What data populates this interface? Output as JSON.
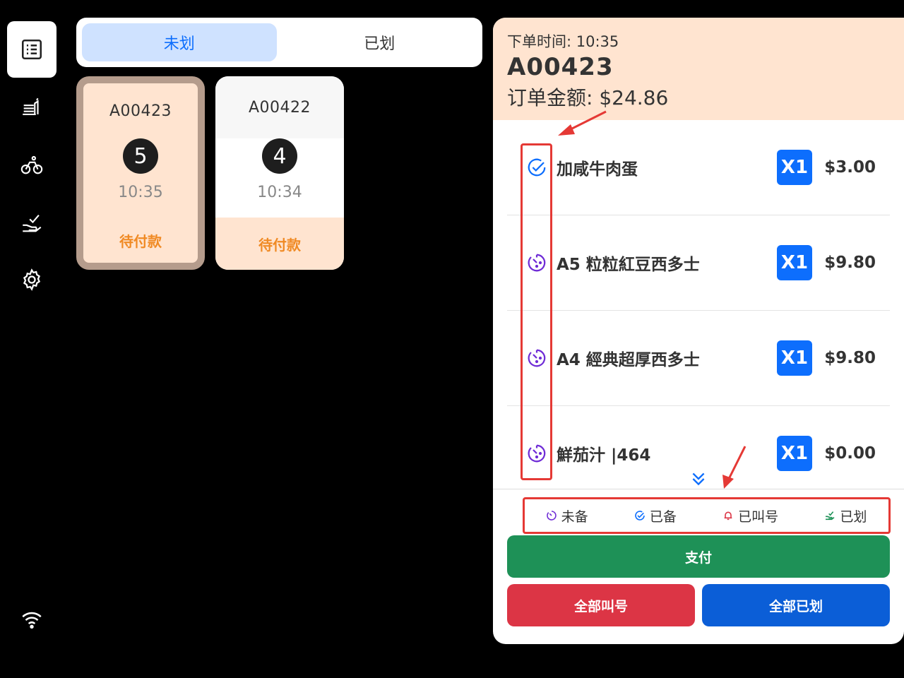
{
  "sidebar": {
    "items": [
      {
        "icon": "order-list-icon",
        "active": true
      },
      {
        "icon": "kitchen-icon",
        "active": false
      },
      {
        "icon": "delivery-bike-icon",
        "active": false
      },
      {
        "icon": "served-hand-icon",
        "active": false
      },
      {
        "icon": "gear-icon",
        "active": false
      }
    ],
    "bottom_icon": "wifi-icon"
  },
  "tabs": [
    {
      "label": "未划",
      "active": true
    },
    {
      "label": "已划",
      "active": false
    }
  ],
  "orders": [
    {
      "id": "A00423",
      "number": "5",
      "time": "10:35",
      "status": "待付款",
      "selected": true
    },
    {
      "id": "A00422",
      "number": "4",
      "time": "10:34",
      "status": "待付款",
      "selected": false
    }
  ],
  "detail": {
    "order_time": "下单时间: 10:35",
    "order_id": "A00423",
    "order_total": "订单金额: $24.86",
    "items": [
      {
        "status_icon": "check-circle-icon",
        "name": "加咸牛肉蛋",
        "qty": "X1",
        "price": "$3.00"
      },
      {
        "status_icon": "timer-icon",
        "name": "A5 粒粒紅豆西多士",
        "qty": "X1",
        "price": "$9.80"
      },
      {
        "status_icon": "timer-icon",
        "name": "A4 經典超厚西多士",
        "qty": "X1",
        "price": "$9.80"
      },
      {
        "status_icon": "timer-icon",
        "name": "鮮茄汁 |464",
        "qty": "X1",
        "price": "$0.00"
      }
    ],
    "legend": [
      {
        "icon": "timer-icon",
        "label": "未备"
      },
      {
        "icon": "check-circle-icon",
        "label": "已备"
      },
      {
        "icon": "bell-icon",
        "label": "已叫号"
      },
      {
        "icon": "served-hand-icon",
        "label": "已划"
      }
    ],
    "buttons": {
      "pay": "支付",
      "call_all": "全部叫号",
      "mark_all": "全部已划"
    }
  },
  "colors": {
    "accent_blue": "#0d6efd",
    "pay_green": "#1e9157",
    "call_red": "#dc3545",
    "pending_orange": "#f08a24",
    "order_peach": "#ffe4d0",
    "timer_purple": "#6f2cd6",
    "annotation_red": "#e53935"
  }
}
